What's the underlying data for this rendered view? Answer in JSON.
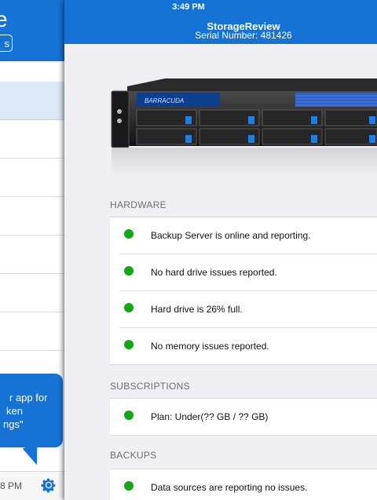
{
  "status_bar": {
    "time": "3:49 PM"
  },
  "sidebar": {
    "title_fragment": "e",
    "button_fragment": "s",
    "tooltip_lines": [
      "r app for",
      "ken",
      "ngs\""
    ],
    "footer_text_fragment": "8 PM"
  },
  "header": {
    "title": "StorageReview",
    "serial_label": "Serial Number:",
    "serial_value": "481426"
  },
  "sections": [
    {
      "title": "HARDWARE",
      "items": [
        {
          "status": "ok",
          "text": "Backup Server is online and reporting."
        },
        {
          "status": "ok",
          "text": "No hard drive issues reported."
        },
        {
          "status": "ok",
          "text": "Hard drive is 26% full."
        },
        {
          "status": "ok",
          "text": "No memory issues reported."
        }
      ]
    },
    {
      "title": "SUBSCRIPTIONS",
      "items": [
        {
          "status": "ok",
          "text": "Plan: Under(?? GB / ?? GB)"
        }
      ]
    },
    {
      "title": "BACKUPS",
      "items": [
        {
          "status": "ok",
          "text": "Data sources are reporting no issues."
        }
      ]
    }
  ],
  "colors": {
    "accent": "#1673d6",
    "status_ok": "#13a718",
    "background": "#efeff4"
  },
  "icons": {
    "settings": "gear-icon",
    "status": "status-dot-icon"
  }
}
